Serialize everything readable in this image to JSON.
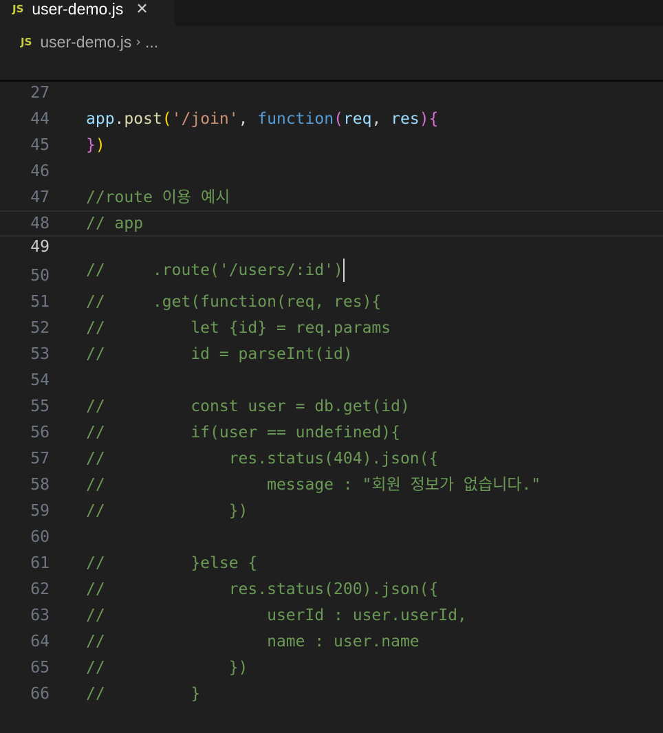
{
  "tab": {
    "icon": "JS",
    "filename": "user-demo.js",
    "close": "✕"
  },
  "breadcrumb": {
    "icon": "JS",
    "file": "user-demo.js",
    "sep": "›",
    "more": "..."
  },
  "sticky_line": {
    "number": "27",
    "tokens": {
      "app": "app",
      "dot": ".",
      "post": "post",
      "open": "(",
      "path": "'/join'",
      "comma": ", ",
      "kw": "function",
      "popen": "(",
      "req": "req",
      "comma2": ", ",
      "res": "res",
      "pclose": ")",
      "brace": "{"
    }
  },
  "lines": [
    {
      "n": "44",
      "text": ""
    },
    {
      "n": "45",
      "text": ""
    },
    {
      "n": "46",
      "text": "//route 이용 예시"
    },
    {
      "n": "47",
      "text": "// app"
    },
    {
      "n": "48",
      "text": ""
    },
    {
      "n": "49",
      "text": "//     .route('/users/:id')"
    },
    {
      "n": "50",
      "text": "//     .get(function(req, res){"
    },
    {
      "n": "51",
      "text": "//         let {id} = req.params"
    },
    {
      "n": "52",
      "text": "//         id = parseInt(id)"
    },
    {
      "n": "53",
      "text": ""
    },
    {
      "n": "54",
      "text": "//         const user = db.get(id)"
    },
    {
      "n": "55",
      "text": "//         if(user == undefined){"
    },
    {
      "n": "56",
      "text": "//             res.status(404).json({"
    },
    {
      "n": "57",
      "text": "//                 message : \"회원 정보가 없습니다.\""
    },
    {
      "n": "58",
      "text": "//             })"
    },
    {
      "n": "59",
      "text": ""
    },
    {
      "n": "60",
      "text": "//         }else {"
    },
    {
      "n": "61",
      "text": "//             res.status(200).json({"
    },
    {
      "n": "62",
      "text": "//                 userId : user.userId,"
    },
    {
      "n": "63",
      "text": "//                 name : user.name"
    },
    {
      "n": "64",
      "text": "//             })"
    },
    {
      "n": "65",
      "text": "//         }"
    },
    {
      "n": "66",
      "text": ""
    }
  ],
  "line44_tokens": {
    "brace": "}",
    "paren": ")"
  },
  "colors": {
    "background": "#1f1f1f",
    "comment": "#6a9955",
    "variable": "#9cdcfe",
    "function": "#dcdcaa",
    "string": "#ce9178",
    "keyword": "#569cd6",
    "bracket_level1": "#ffd700",
    "bracket_level2": "#da70d6"
  }
}
